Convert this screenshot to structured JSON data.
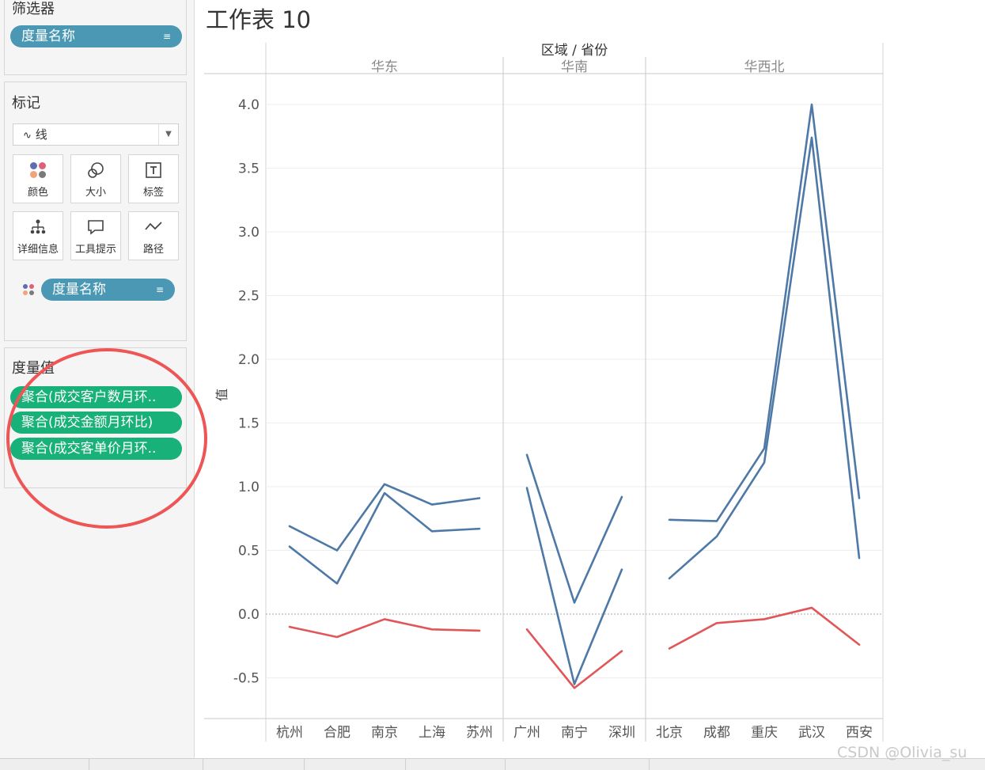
{
  "worksheet_title": "工作表 10",
  "filters_card": {
    "title": "筛选器",
    "pill": "度量名称"
  },
  "marks_card": {
    "title": "标记",
    "mark_type": "线",
    "buttons": [
      "颜色",
      "大小",
      "标签",
      "详细信息",
      "工具提示",
      "路径"
    ],
    "color_pill": "度量名称"
  },
  "measure_values_card": {
    "title": "度量值",
    "pills": [
      "聚合(成交客户数月环..",
      "聚合(成交金额月环比)",
      "聚合(成交客单价月环.."
    ]
  },
  "watermark": "CSDN @Olivia_su",
  "colors": {
    "series_blue": "#4e79a7",
    "series_red": "#e15759",
    "pill_blue": "#4b98b4",
    "pill_green": "#19b17a",
    "annotation_circle": "#ee5555"
  },
  "chart_data": {
    "type": "line",
    "column_header": "区域 / 省份",
    "ylabel": "值",
    "ylim": [
      -0.8,
      4.25
    ],
    "yticks": [
      "4.0",
      "3.5",
      "3.0",
      "2.5",
      "2.0",
      "1.5",
      "1.0",
      "0.5",
      "0.0",
      "-0.5"
    ],
    "ytick_values": [
      4.0,
      3.5,
      3.0,
      2.5,
      2.0,
      1.5,
      1.0,
      0.5,
      0.0,
      -0.5
    ],
    "panes": [
      {
        "region": "华东",
        "categories": [
          "杭州",
          "合肥",
          "南京",
          "上海",
          "苏州"
        ],
        "series": [
          {
            "color": "#4e79a7",
            "values": [
              0.69,
              0.5,
              1.02,
              0.86,
              0.91
            ]
          },
          {
            "color": "#4e79a7",
            "values": [
              0.53,
              0.24,
              0.95,
              0.65,
              0.67
            ]
          },
          {
            "color": "#e15759",
            "values": [
              -0.1,
              -0.18,
              -0.04,
              -0.12,
              -0.13
            ]
          }
        ]
      },
      {
        "region": "华南",
        "categories": [
          "广州",
          "南宁",
          "深圳"
        ],
        "series": [
          {
            "color": "#4e79a7",
            "values": [
              1.25,
              0.09,
              0.92
            ]
          },
          {
            "color": "#4e79a7",
            "values": [
              0.99,
              -0.55,
              0.35
            ]
          },
          {
            "color": "#e15759",
            "values": [
              -0.12,
              -0.58,
              -0.29
            ]
          }
        ]
      },
      {
        "region": "华西北",
        "categories": [
          "北京",
          "成都",
          "重庆",
          "武汉",
          "西安"
        ],
        "series": [
          {
            "color": "#4e79a7",
            "values": [
              0.74,
              0.73,
              1.3,
              4.0,
              0.91
            ]
          },
          {
            "color": "#4e79a7",
            "values": [
              0.28,
              0.61,
              1.19,
              3.74,
              0.44
            ]
          },
          {
            "color": "#e15759",
            "values": [
              -0.27,
              -0.07,
              -0.04,
              0.05,
              -0.24
            ]
          }
        ]
      }
    ]
  }
}
